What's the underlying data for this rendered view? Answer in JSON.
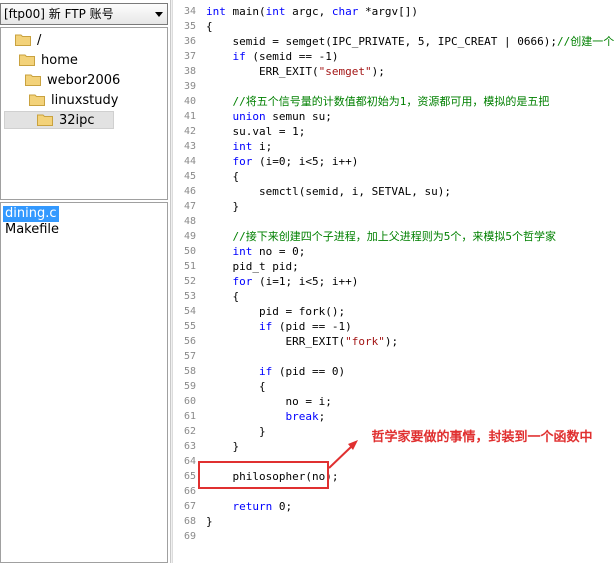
{
  "ftp_combo": {
    "label": "[ftp00] 新 FTP 账号"
  },
  "tree": {
    "items": [
      {
        "label": "/"
      },
      {
        "label": "home"
      },
      {
        "label": "webor2006"
      },
      {
        "label": "linuxstudy"
      },
      {
        "label": "32ipc",
        "selected": true
      }
    ]
  },
  "files": {
    "items": [
      {
        "label": "dining.c",
        "selected": true
      },
      {
        "label": "Makefile"
      }
    ]
  },
  "editor": {
    "lines": [
      {
        "n": "34",
        "text": "int main(int argc, char *argv[])"
      },
      {
        "n": "35",
        "text": "{"
      },
      {
        "n": "36",
        "text": "    semid = semget(IPC_PRIVATE, 5, IPC_CREAT | 0666);//创建一个"
      },
      {
        "n": "37",
        "text": "    if (semid == -1)"
      },
      {
        "n": "38",
        "text": "        ERR_EXIT(\"semget\");"
      },
      {
        "n": "39",
        "text": ""
      },
      {
        "n": "40",
        "text": "    //将五个信号量的计数值都初始为1，资源都可用，模拟的是五把"
      },
      {
        "n": "41",
        "text": "    union semun su;"
      },
      {
        "n": "42",
        "text": "    su.val = 1;"
      },
      {
        "n": "43",
        "text": "    int i;"
      },
      {
        "n": "44",
        "text": "    for (i=0; i<5; i++)"
      },
      {
        "n": "45",
        "text": "    {"
      },
      {
        "n": "46",
        "text": "        semctl(semid, i, SETVAL, su);"
      },
      {
        "n": "47",
        "text": "    }"
      },
      {
        "n": "48",
        "text": ""
      },
      {
        "n": "49",
        "text": "    //接下来创建四个子进程，加上父进程则为5个，来模拟5个哲学家"
      },
      {
        "n": "50",
        "text": "    int no = 0;"
      },
      {
        "n": "51",
        "text": "    pid_t pid;"
      },
      {
        "n": "52",
        "text": "    for (i=1; i<5; i++)"
      },
      {
        "n": "53",
        "text": "    {"
      },
      {
        "n": "54",
        "text": "        pid = fork();"
      },
      {
        "n": "55",
        "text": "        if (pid == -1)"
      },
      {
        "n": "56",
        "text": "            ERR_EXIT(\"fork\");"
      },
      {
        "n": "57",
        "text": ""
      },
      {
        "n": "58",
        "text": "        if (pid == 0)"
      },
      {
        "n": "59",
        "text": "        {"
      },
      {
        "n": "60",
        "text": "            no = i;"
      },
      {
        "n": "61",
        "text": "            break;"
      },
      {
        "n": "62",
        "text": "        }"
      },
      {
        "n": "63",
        "text": "    }"
      },
      {
        "n": "64",
        "text": ""
      },
      {
        "n": "65",
        "text": "    philosopher(no);"
      },
      {
        "n": "66",
        "text": ""
      },
      {
        "n": "67",
        "text": "    return 0;"
      },
      {
        "n": "68",
        "text": "}"
      },
      {
        "n": "69",
        "text": ""
      }
    ]
  },
  "annotation": {
    "text": "哲学家要做的事情，封装到一个函数中",
    "color": "#e03030"
  },
  "colors": {
    "keyword": "#0000ff",
    "string": "#a31515",
    "comment": "#008000",
    "selection": "#3399ff"
  }
}
